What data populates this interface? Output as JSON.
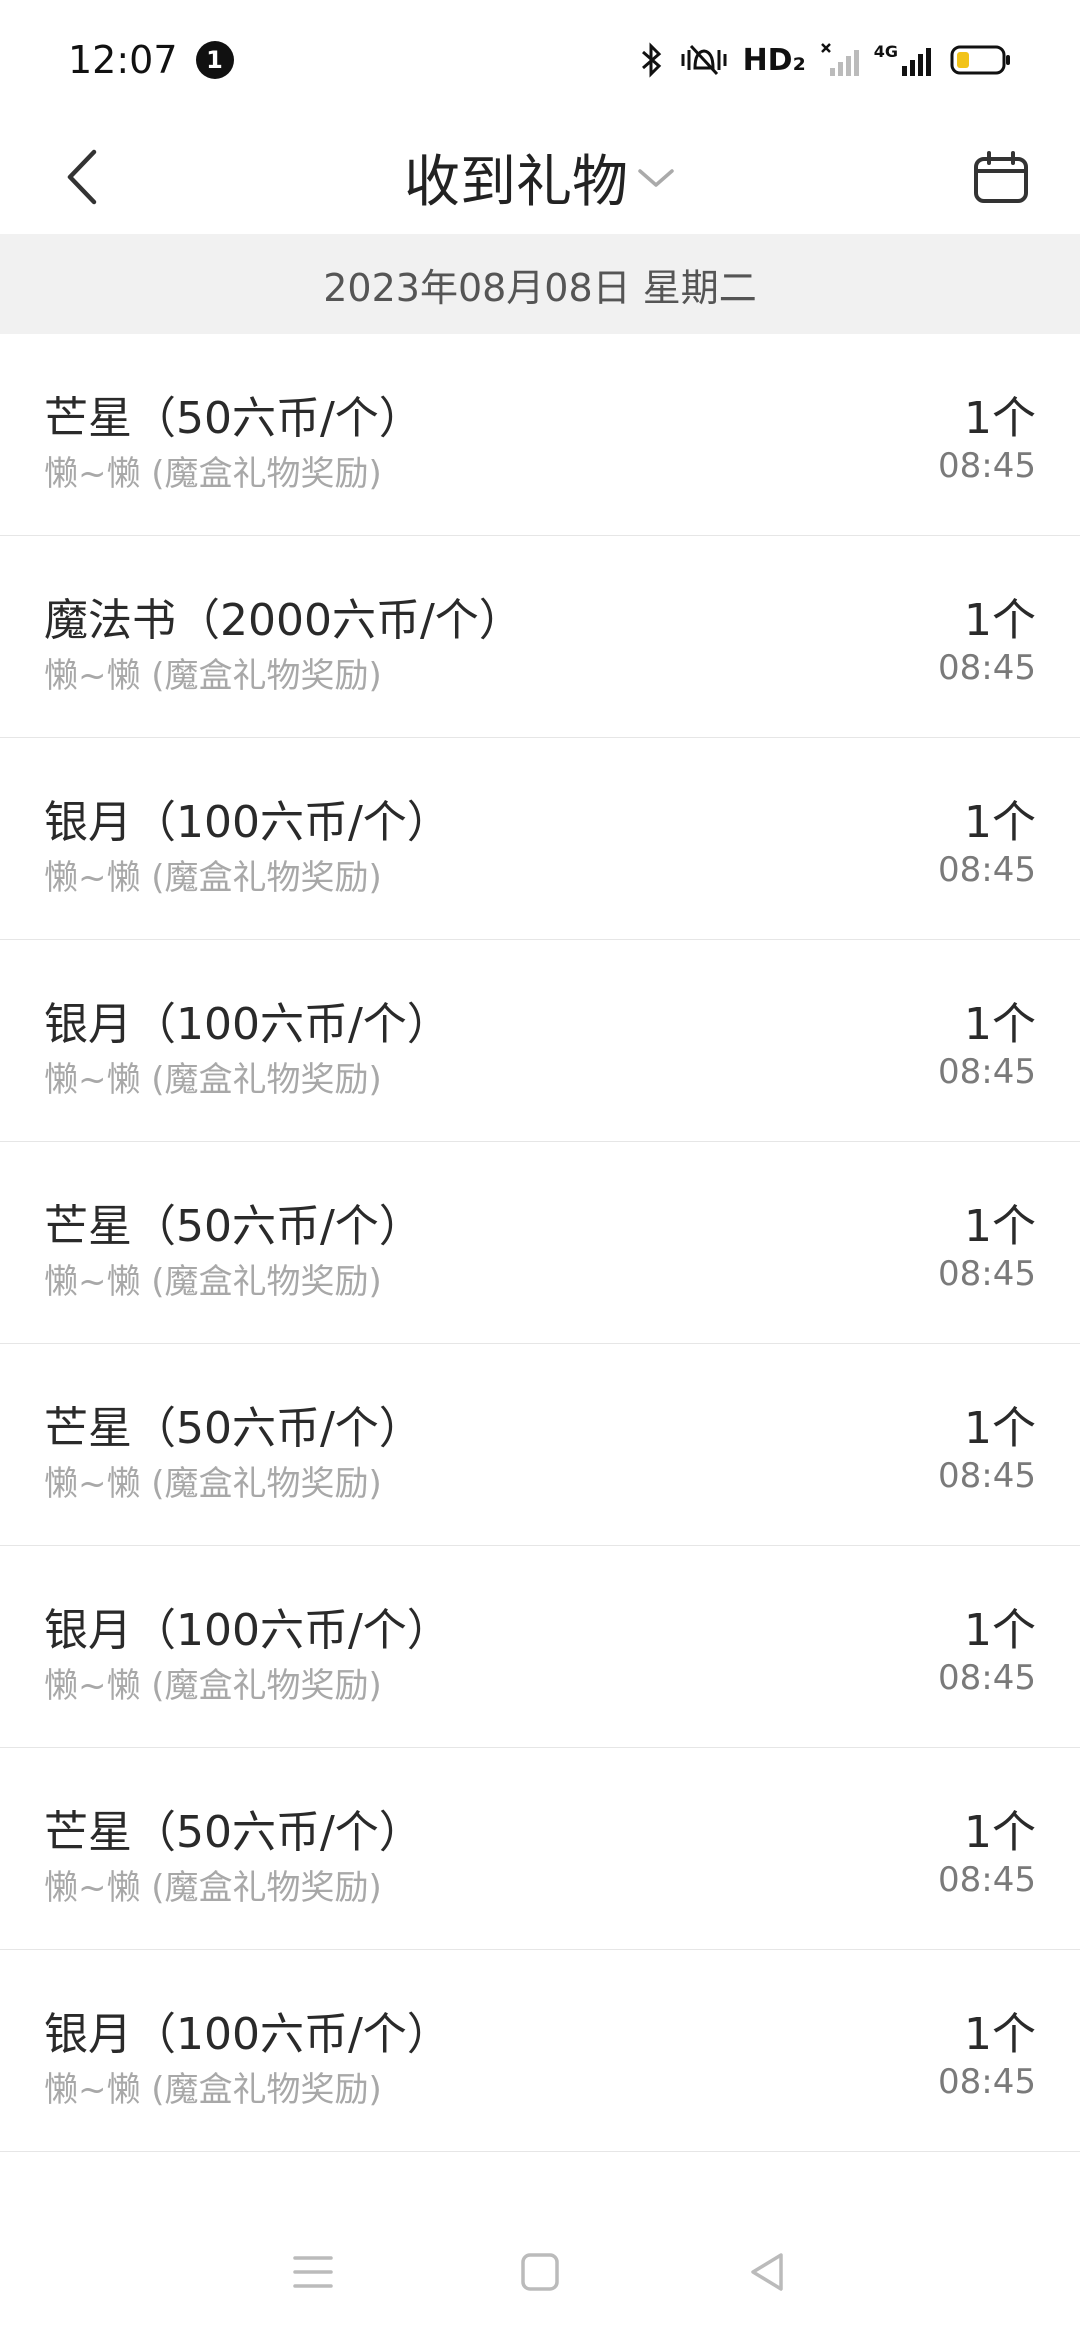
{
  "status_bar": {
    "time": "12:07",
    "notification_count": "1",
    "hd_label": "HD₂",
    "network_label": "4G",
    "icons": [
      "bluetooth-icon",
      "vibrate-mute-icon",
      "hd-icon",
      "sim1-signal-icon",
      "sim2-4g-signal-icon",
      "battery-icon"
    ],
    "battery_color": "#f2c318"
  },
  "header": {
    "title": "收到礼物",
    "icons": [
      "back-arrow-icon",
      "chevron-down-icon",
      "calendar-icon"
    ]
  },
  "date_bar": {
    "label": "2023年08月08日 星期二"
  },
  "gifts": [
    {
      "name": "芒星（50六币/个）",
      "sender": "懒~懒 (魔盒礼物奖励)",
      "qty": "1个",
      "time": "08:45"
    },
    {
      "name": "魔法书（2000六币/个）",
      "sender": "懒~懒 (魔盒礼物奖励)",
      "qty": "1个",
      "time": "08:45"
    },
    {
      "name": "银月（100六币/个）",
      "sender": "懒~懒 (魔盒礼物奖励)",
      "qty": "1个",
      "time": "08:45"
    },
    {
      "name": "银月（100六币/个）",
      "sender": "懒~懒 (魔盒礼物奖励)",
      "qty": "1个",
      "time": "08:45"
    },
    {
      "name": "芒星（50六币/个）",
      "sender": "懒~懒 (魔盒礼物奖励)",
      "qty": "1个",
      "time": "08:45"
    },
    {
      "name": "芒星（50六币/个）",
      "sender": "懒~懒 (魔盒礼物奖励)",
      "qty": "1个",
      "time": "08:45"
    },
    {
      "name": "银月（100六币/个）",
      "sender": "懒~懒 (魔盒礼物奖励)",
      "qty": "1个",
      "time": "08:45"
    },
    {
      "name": "芒星（50六币/个）",
      "sender": "懒~懒 (魔盒礼物奖励)",
      "qty": "1个",
      "time": "08:45"
    },
    {
      "name": "银月（100六币/个）",
      "sender": "懒~懒 (魔盒礼物奖励)",
      "qty": "1个",
      "time": "08:45"
    }
  ],
  "nav_bar": {
    "icons": [
      "menu-icon",
      "home-square-icon",
      "back-triangle-icon"
    ]
  }
}
